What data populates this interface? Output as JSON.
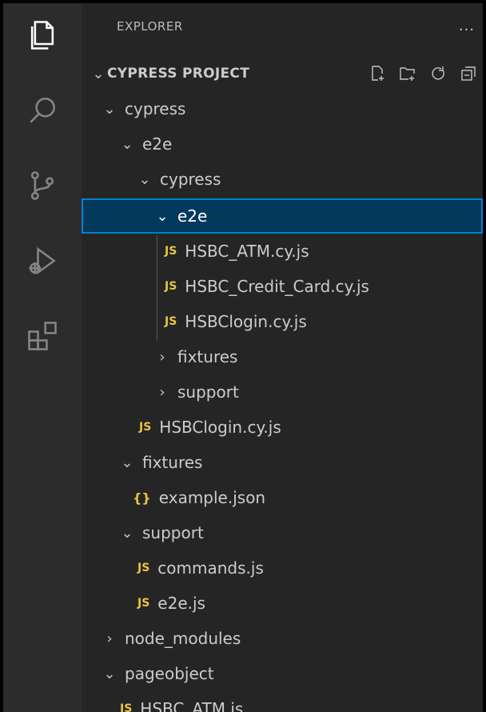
{
  "activity_bar": {
    "icons": [
      "files-icon",
      "search-icon",
      "source-control-icon",
      "run-debug-icon",
      "extensions-icon"
    ]
  },
  "explorer": {
    "header": "EXPLORER",
    "more": "...",
    "project": "CYPRESS PROJECT",
    "tree": [
      {
        "label": "cypress",
        "type": "folder",
        "expanded": true
      },
      {
        "label": "e2e",
        "type": "folder",
        "expanded": true
      },
      {
        "label": "cypress",
        "type": "folder",
        "expanded": true
      },
      {
        "label": "e2e",
        "type": "folder",
        "expanded": true,
        "selected": true
      },
      {
        "label": "HSBC_ATM.cy.js",
        "type": "js"
      },
      {
        "label": "HSBC_Credit_Card.cy.js",
        "type": "js"
      },
      {
        "label": "HSBClogin.cy.js",
        "type": "js"
      },
      {
        "label": "fixtures",
        "type": "folder",
        "expanded": false
      },
      {
        "label": "support",
        "type": "folder",
        "expanded": false
      },
      {
        "label": "HSBClogin.cy.js",
        "type": "js"
      },
      {
        "label": "fixtures",
        "type": "folder",
        "expanded": true
      },
      {
        "label": "example.json",
        "type": "json"
      },
      {
        "label": "support",
        "type": "folder",
        "expanded": true
      },
      {
        "label": "commands.js",
        "type": "js"
      },
      {
        "label": "e2e.js",
        "type": "js"
      },
      {
        "label": "node_modules",
        "type": "folder",
        "expanded": false
      },
      {
        "label": "pageobject",
        "type": "folder",
        "expanded": true
      },
      {
        "label": "HSBC_ATM.js",
        "type": "js"
      }
    ],
    "badges": {
      "js": "JS",
      "json": "{}"
    }
  },
  "colors": {
    "selection_bg": "#04395e",
    "selection_border": "#007fd4",
    "js_badge": "#e8c542"
  }
}
